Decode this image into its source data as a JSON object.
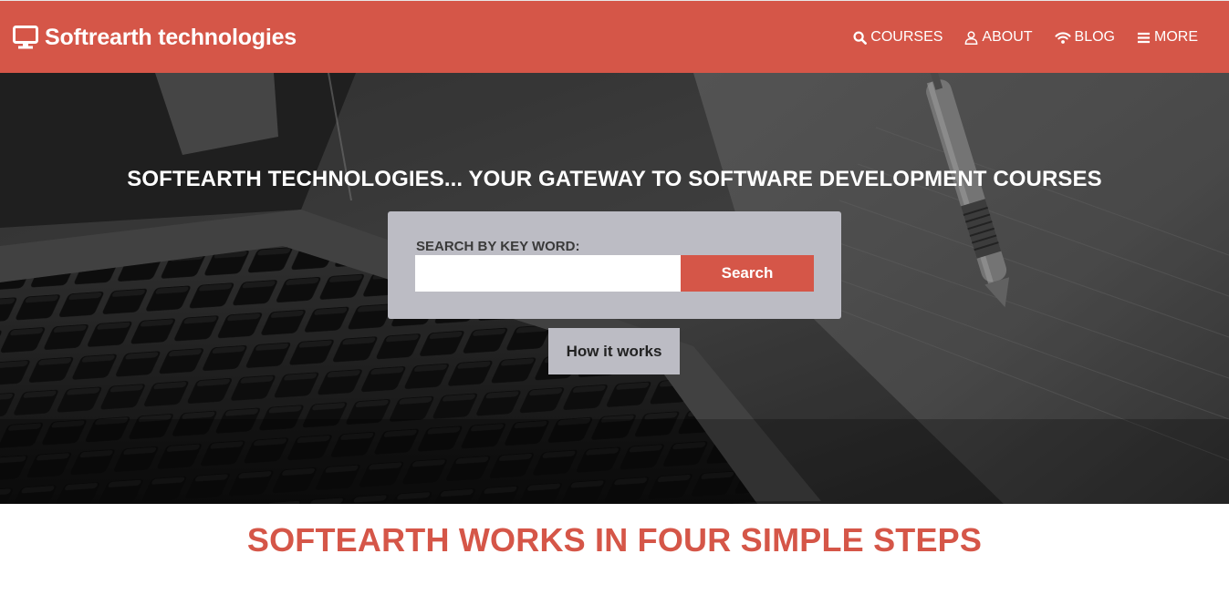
{
  "navbar": {
    "brand": {
      "icon": "monitor-icon",
      "label": "Softrearth technologies"
    },
    "items": [
      {
        "icon": "search-icon",
        "label": "COURSES"
      },
      {
        "icon": "user-icon",
        "label": "ABOUT"
      },
      {
        "icon": "wifi-icon",
        "label": "BLOG"
      },
      {
        "icon": "menu-icon",
        "label": "MORE"
      }
    ]
  },
  "hero": {
    "title": "SOFTEARTH TECHNOLOGIES... YOUR GATEWAY TO SOFTWARE DEVELOPMENT COURSES",
    "search": {
      "label": "SEARCH BY KEY WORD:",
      "value": "",
      "button_label": "Search"
    },
    "how_button_label": "How it works"
  },
  "steps_section": {
    "title": "SOFTEARTH WORKS IN FOUR SIMPLE STEPS"
  },
  "colors": {
    "brand": "#d55648",
    "search_panel": "#bcbcc4",
    "hero_background": "#1c1c1c",
    "text_on_brand": "#ffffff"
  }
}
